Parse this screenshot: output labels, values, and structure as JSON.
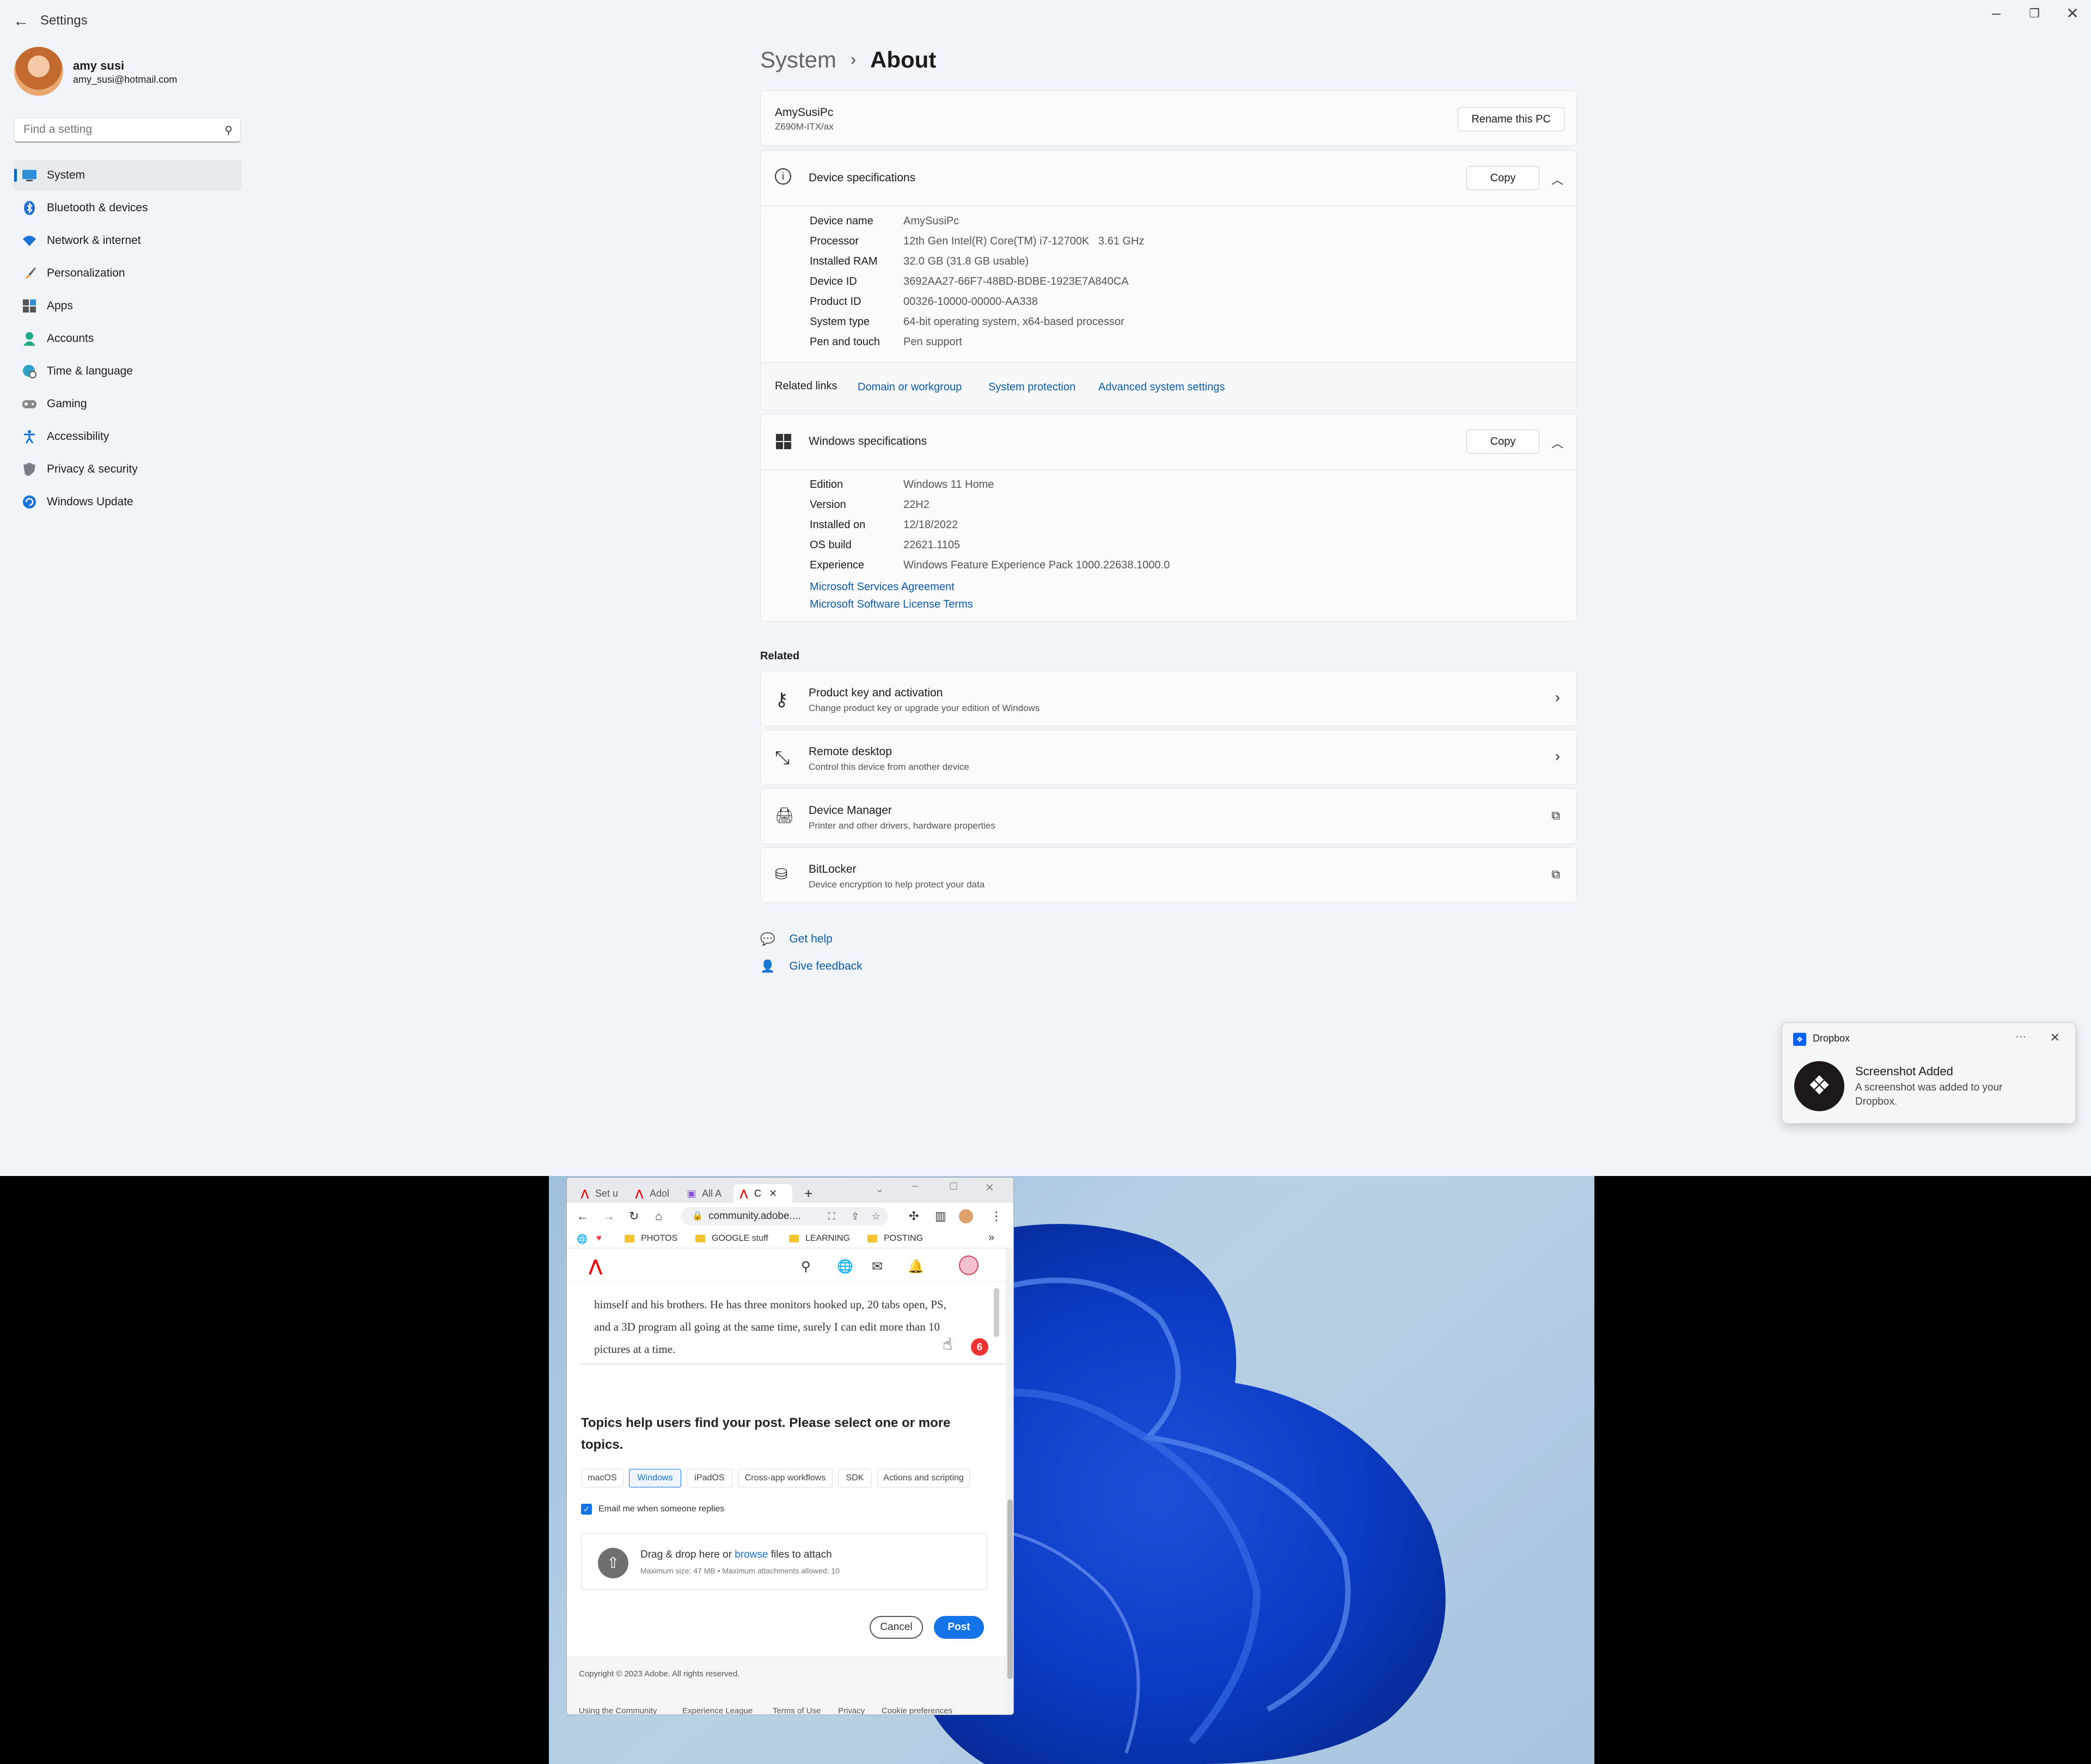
{
  "window": {
    "title": "Settings",
    "back_icon": "arrow-left-icon"
  },
  "user": {
    "name": "amy susi",
    "email": "amy_susi@hotmail.com"
  },
  "search": {
    "placeholder": "Find a setting"
  },
  "nav": [
    {
      "label": "System",
      "icon": "monitor-icon",
      "active": true
    },
    {
      "label": "Bluetooth & devices",
      "icon": "bluetooth-icon"
    },
    {
      "label": "Network & internet",
      "icon": "wifi-icon"
    },
    {
      "label": "Personalization",
      "icon": "brush-icon"
    },
    {
      "label": "Apps",
      "icon": "apps-icon"
    },
    {
      "label": "Accounts",
      "icon": "person-icon"
    },
    {
      "label": "Time & language",
      "icon": "globe-clock-icon"
    },
    {
      "label": "Gaming",
      "icon": "gamepad-icon"
    },
    {
      "label": "Accessibility",
      "icon": "accessibility-icon"
    },
    {
      "label": "Privacy & security",
      "icon": "shield-icon"
    },
    {
      "label": "Windows Update",
      "icon": "update-icon"
    }
  ],
  "breadcrumb": {
    "parent": "System",
    "separator": "›",
    "current": "About"
  },
  "pc": {
    "name": "AmySusiPc",
    "model": "Z690M-ITX/ax",
    "rename_label": "Rename this PC"
  },
  "device_specs": {
    "title": "Device specifications",
    "copy_label": "Copy",
    "rows": [
      {
        "k": "Device name",
        "v": "AmySusiPc"
      },
      {
        "k": "Processor",
        "v": "12th Gen Intel(R) Core(TM) i7-12700K   3.61 GHz"
      },
      {
        "k": "Installed RAM",
        "v": "32.0 GB (31.8 GB usable)"
      },
      {
        "k": "Device ID",
        "v": "3692AA27-66F7-48BD-BDBE-1923E7A840CA"
      },
      {
        "k": "Product ID",
        "v": "00326-10000-00000-AA338"
      },
      {
        "k": "System type",
        "v": "64-bit operating system, x64-based processor"
      },
      {
        "k": "Pen and touch",
        "v": "Pen support"
      }
    ],
    "related_links_label": "Related links",
    "related_links": [
      "Domain or workgroup",
      "System protection",
      "Advanced system settings"
    ]
  },
  "windows_specs": {
    "title": "Windows specifications",
    "copy_label": "Copy",
    "rows": [
      {
        "k": "Edition",
        "v": "Windows 11 Home"
      },
      {
        "k": "Version",
        "v": "22H2"
      },
      {
        "k": "Installed on",
        "v": "12/18/2022"
      },
      {
        "k": "OS build",
        "v": "22621.1105"
      },
      {
        "k": "Experience",
        "v": "Windows Feature Experience Pack 1000.22638.1000.0"
      }
    ],
    "links": [
      "Microsoft Services Agreement",
      "Microsoft Software License Terms"
    ]
  },
  "related": {
    "heading": "Related",
    "items": [
      {
        "title": "Product key and activation",
        "desc": "Change product key or upgrade your edition of Windows",
        "icon": "key-icon",
        "action": "chevron-right-icon"
      },
      {
        "title": "Remote desktop",
        "desc": "Control this device from another device",
        "icon": "remote-desktop-icon",
        "action": "chevron-right-icon"
      },
      {
        "title": "Device Manager",
        "desc": "Printer and other drivers, hardware properties",
        "icon": "device-manager-icon",
        "action": "external-link-icon"
      },
      {
        "title": "BitLocker",
        "desc": "Device encryption to help protect your data",
        "icon": "bitlocker-icon",
        "action": "external-link-icon"
      }
    ]
  },
  "help": {
    "get_help": "Get help",
    "give_feedback": "Give feedback"
  },
  "toast": {
    "app": "Dropbox",
    "title": "Screenshot Added",
    "body": "A screenshot was added to your Dropbox."
  },
  "browser": {
    "tabs": [
      "Set u",
      "Adol",
      "All A",
      "C"
    ],
    "new_tab": "+",
    "url": "community.adobe....",
    "bookmarks": [
      "PHOTOS",
      "GOOGLE stuff",
      "LEARNING",
      "POSTING"
    ],
    "more_bookmarks": "»",
    "post_text": "himself and his brothers. He has three monitors hooked up, 20 tabs open, PS, and a 3D program all going at the same time, surely I can edit more than 10 pictures at a time.",
    "badge_count": "6",
    "topics_heading": "Topics help users find your post. Please select one or more topics.",
    "topics": [
      "macOS",
      "Windows",
      "iPadOS",
      "Cross-app workflows",
      "SDK",
      "Actions and scripting"
    ],
    "selected_topic": "Windows",
    "email_checkbox": "Email me when someone replies",
    "attach_prefix": "Drag & drop here or ",
    "attach_link": "browse",
    "attach_suffix": " files to attach",
    "attach_limits": "Maximum size: 47 MB • Maximum attachments allowed: 10",
    "cancel": "Cancel",
    "post": "Post",
    "copyright": "Copyright © 2023 Adobe. All rights reserved.",
    "footer_links": [
      "Using the Community",
      "Experience League",
      "Terms of Use",
      "Privacy",
      "Cookie preferences"
    ]
  },
  "colors": {
    "accent": "#0067c0",
    "link": "#0d5bab",
    "adobe_blue": "#1473e6",
    "dropbox_blue": "#0061fe"
  }
}
